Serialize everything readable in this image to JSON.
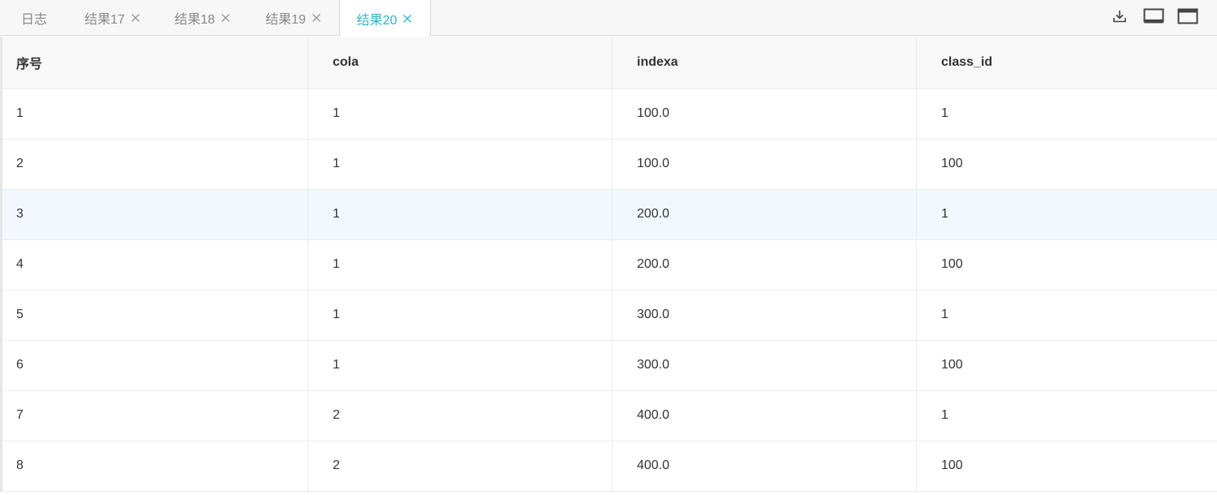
{
  "tabs": [
    {
      "label": "日志",
      "closable": false,
      "active": false
    },
    {
      "label": "结果17",
      "closable": true,
      "active": false
    },
    {
      "label": "结果18",
      "closable": true,
      "active": false
    },
    {
      "label": "结果19",
      "closable": true,
      "active": false
    },
    {
      "label": "结果20",
      "closable": true,
      "active": true
    }
  ],
  "toolbar": {
    "icons": [
      "download-icon",
      "restore-panel-icon",
      "maximize-panel-icon"
    ]
  },
  "table": {
    "columns": [
      "序号",
      "cola",
      "indexa",
      "class_id"
    ],
    "rows": [
      [
        "1",
        "1",
        "100.0",
        "1"
      ],
      [
        "2",
        "1",
        "100.0",
        "100"
      ],
      [
        "3",
        "1",
        "200.0",
        "1"
      ],
      [
        "4",
        "1",
        "200.0",
        "100"
      ],
      [
        "5",
        "1",
        "300.0",
        "1"
      ],
      [
        "6",
        "1",
        "300.0",
        "100"
      ],
      [
        "7",
        "2",
        "400.0",
        "1"
      ],
      [
        "8",
        "2",
        "400.0",
        "100"
      ]
    ],
    "highlighted_row": 2
  },
  "colors": {
    "accent": "#2db7c9",
    "tab_text": "#888888",
    "header_bg": "#f8f8f8",
    "highlight_bg": "#f2f8fd"
  }
}
